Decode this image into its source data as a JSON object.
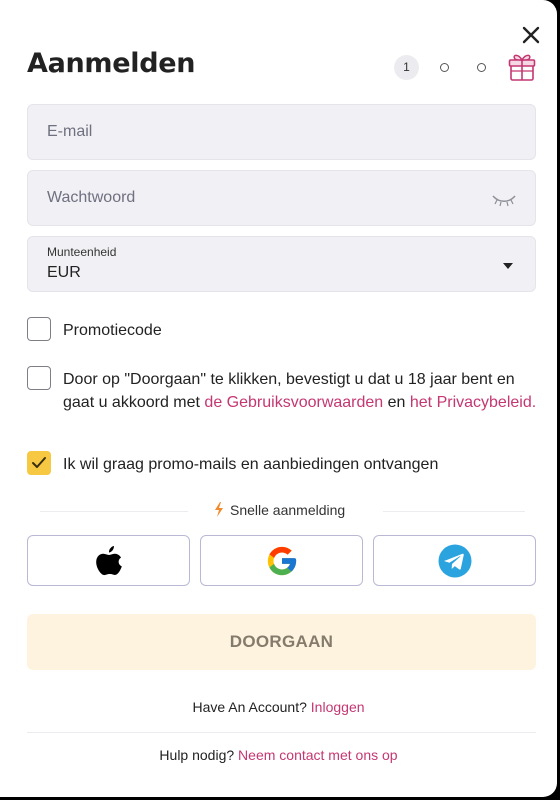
{
  "modal": {
    "title": "Aanmelden",
    "close_icon": "close-icon",
    "steps": {
      "current": "1",
      "total_dots": 2,
      "reward_icon": "gift-icon"
    }
  },
  "form": {
    "email": {
      "placeholder": "E-mail"
    },
    "password": {
      "placeholder": "Wachtwoord",
      "icon": "eye-closed-icon"
    },
    "currency": {
      "label": "Munteenheid",
      "value": "EUR"
    },
    "promo_code": {
      "label": "Promotiecode",
      "checked": false
    },
    "terms": {
      "checked": false,
      "text_before": "Door op \"Doorgaan\" te klikken, bevestigt u dat u 18 jaar bent en gaat u akkoord met ",
      "terms_link": "de Gebruiksvoorwaarden",
      "text_middle": " en ",
      "privacy_link": "het Privacybeleid.",
      "text_after": ""
    },
    "promo_mails": {
      "label": "Ik wil graag promo-mails en aanbiedingen ontvangen",
      "checked": true
    }
  },
  "quick_signup": {
    "label": "Snelle aanmelding",
    "providers": [
      "apple-icon",
      "google-icon",
      "telegram-icon"
    ]
  },
  "submit_label": "DOORGAAN",
  "footer": {
    "have_account": "Have An Account?",
    "login_link": "Inloggen",
    "help_text": "Hulp nodig?",
    "contact_link": "Neem contact met ons op"
  },
  "colors": {
    "accent_pink": "#c43772",
    "checkbox_yellow": "#f7c842",
    "submit_bg": "#fdf3df",
    "telegram_blue": "#2aa3df"
  }
}
